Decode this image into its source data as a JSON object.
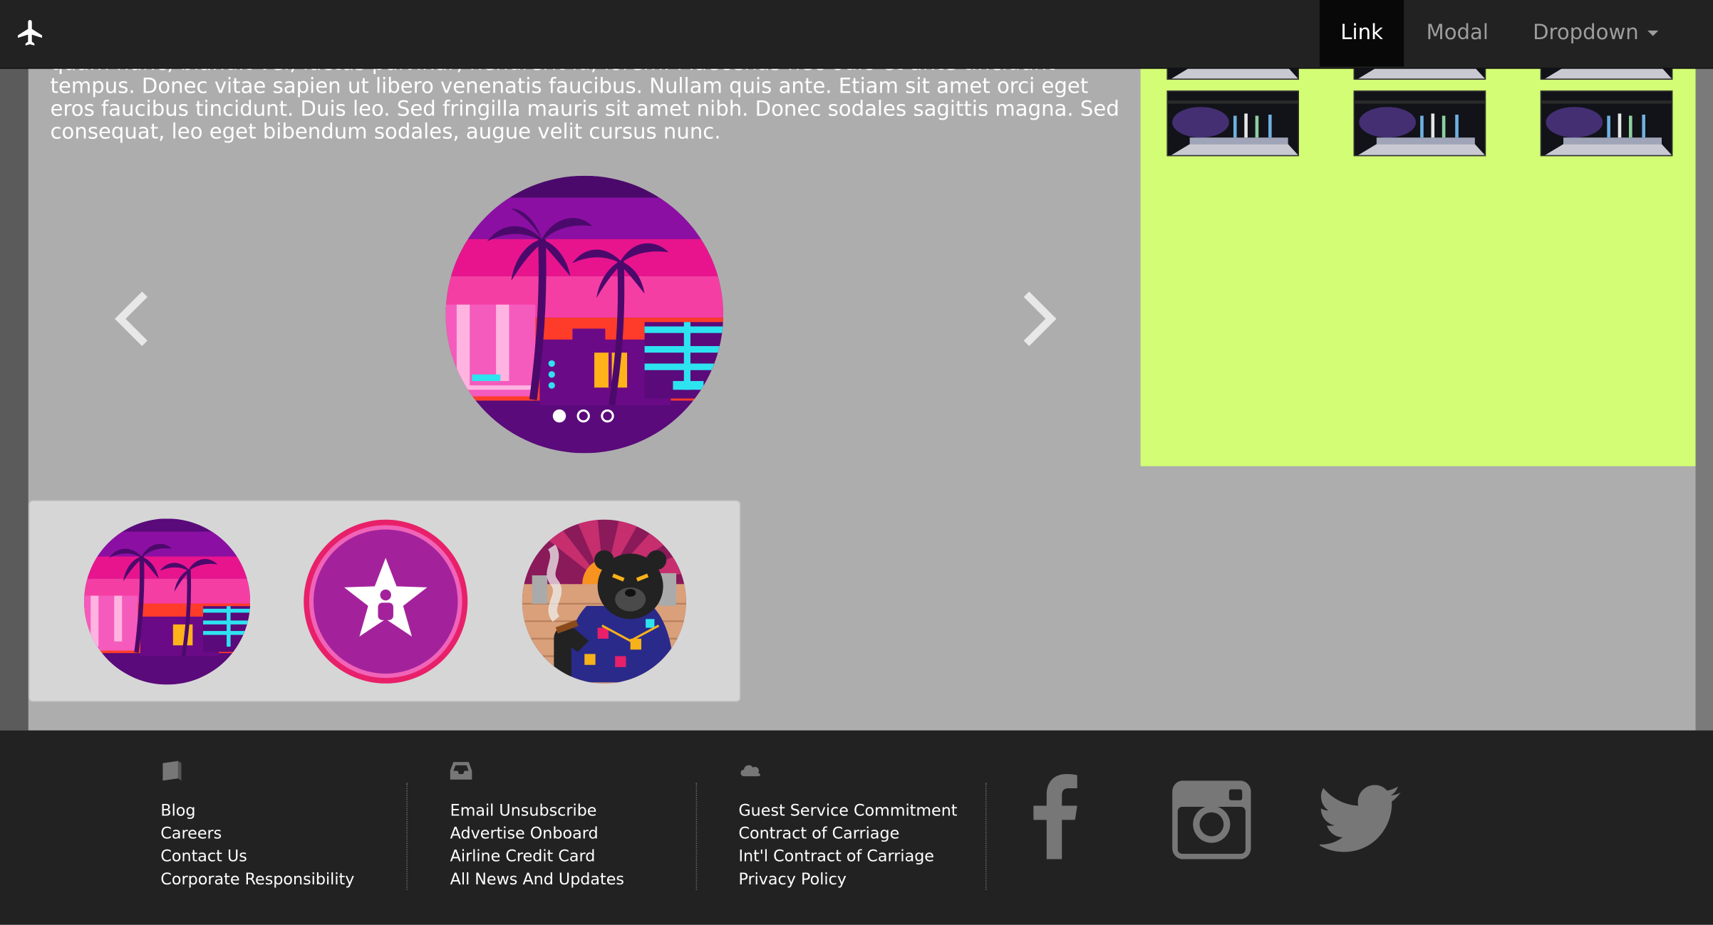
{
  "navbar": {
    "brand_icon": "airplane-icon",
    "links": [
      {
        "label": "Link",
        "active": true
      },
      {
        "label": "Modal",
        "active": false
      },
      {
        "label": "Dropdown",
        "active": false
      }
    ]
  },
  "intro_text": "quam nunc, blandit vel, luctus pulvinar, hendrerit id, lorem. Maecenas nec odio et ante tincidunt tempus. Donec vitae sapien ut libero venenatis faucibus. Nullam quis ante. Etiam sit amet orci eget eros faucibus tincidunt. Duis leo. Sed fringilla mauris sit amet nibh. Donec sodales sagittis magna. Sed consequat, leo eget bibendum sodales, augue velit cursus nunc.",
  "carousel": {
    "prev_icon": "chevron-left-icon",
    "next_icon": "chevron-right-icon",
    "slide_count": 3,
    "active_slide": 1
  },
  "thumbnails": {
    "panel_color": "#d3fd74",
    "count_visible": 6
  },
  "icon_panel": {
    "items": [
      "palm-sunset-icon",
      "star-badge-icon",
      "bear-cigar-icon"
    ]
  },
  "footer": {
    "columns": [
      {
        "icon": "book-icon",
        "links": [
          "Blog",
          "Careers",
          "Contact Us",
          "Corporate Responsibility"
        ]
      },
      {
        "icon": "inbox-icon",
        "links": [
          "Email Unsubscribe",
          "Advertise Onboard",
          "Airline Credit Card",
          "All News And Updates"
        ]
      },
      {
        "icon": "cloud-icon",
        "links": [
          "Guest Service Commitment",
          "Contract of Carriage",
          "Int'l Contract of Carriage",
          "Privacy Policy"
        ]
      }
    ],
    "social": [
      "facebook-icon",
      "instagram-icon",
      "twitter-icon"
    ]
  },
  "colors": {
    "navbar": "#222222",
    "nav_active": "#080808",
    "page": "#adadad",
    "accent_green": "#d3fd74",
    "footer": "#222222"
  }
}
